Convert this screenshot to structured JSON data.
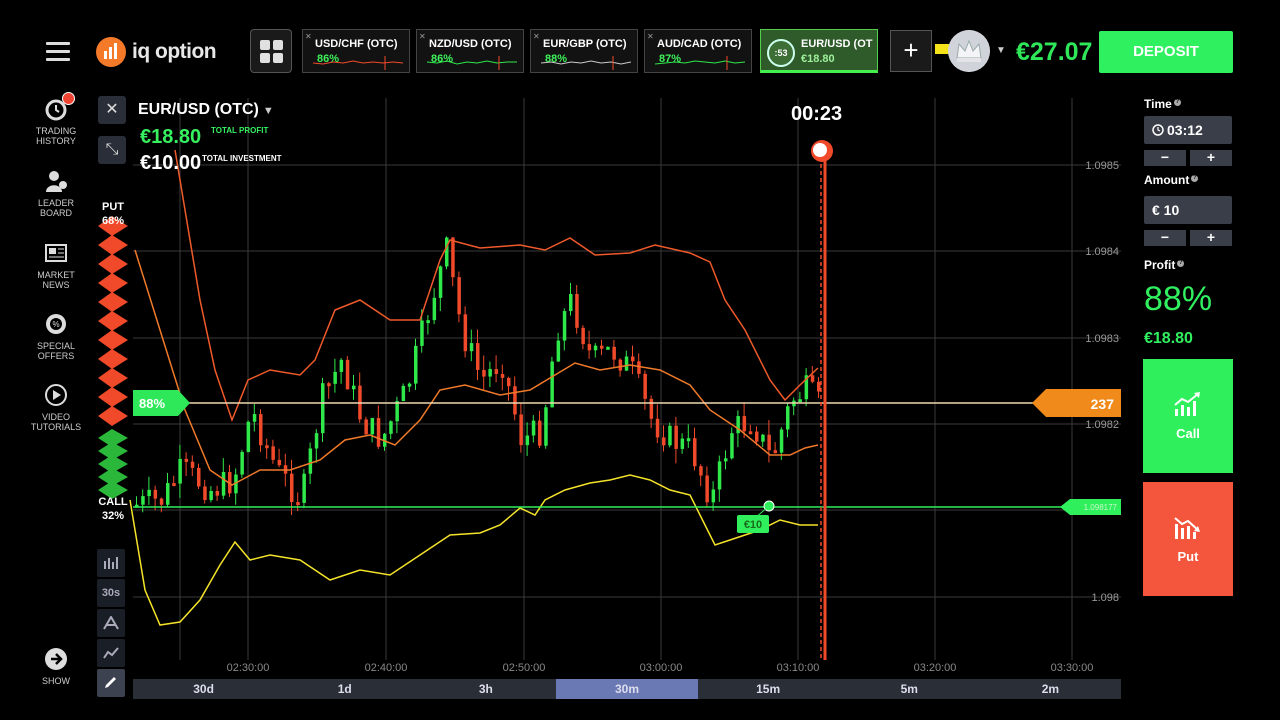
{
  "app": {
    "logo_text": "iq option",
    "balance": "€27.07",
    "deposit_label": "DEPOSIT"
  },
  "asset_tabs": [
    {
      "name": "USD/CHF (OTC)",
      "pct": "86%"
    },
    {
      "name": "NZD/USD (OTC)",
      "pct": "86%"
    },
    {
      "name": "EUR/GBP (OTC)",
      "pct": "88%"
    },
    {
      "name": "AUD/CAD (OTC)",
      "pct": "87%"
    },
    {
      "name": "EUR/USD (OT",
      "pct": "€18.80",
      "timer": ":53",
      "active": true
    }
  ],
  "sidebar": {
    "items": [
      {
        "label_1": "TRADING",
        "label_2": "HISTORY",
        "icon": "history-icon"
      },
      {
        "label_1": "LEADER",
        "label_2": "BOARD",
        "icon": "leaderboard-icon"
      },
      {
        "label_1": "MARKET",
        "label_2": "NEWS",
        "icon": "news-icon"
      },
      {
        "label_1": "SPECIAL",
        "label_2": "OFFERS",
        "icon": "offers-icon"
      },
      {
        "label_1": "VIDEO",
        "label_2": "TUTORIALS",
        "icon": "play-icon"
      },
      {
        "label_1": "SHOW",
        "label_2": "",
        "icon": "arrow-right-icon"
      }
    ]
  },
  "chart_header": {
    "asset": "EUR/USD (OTC)",
    "total_profit": "€18.80",
    "total_profit_label": "TOTAL PROFIT",
    "total_investment": "€10.00",
    "total_investment_label": "TOTAL INVESTMENT",
    "countdown": "00:23"
  },
  "sentiment": {
    "put_label": "PUT",
    "put_pct": "68%",
    "call_label": "CALL",
    "call_pct": "32%"
  },
  "markers": {
    "payout_tag": "88%",
    "right_tag": "237",
    "deal_tag": "€10",
    "strike_tag": "1.098177"
  },
  "tools": [
    "30s"
  ],
  "chart_data": {
    "type": "candlestick",
    "x_ticks": [
      "02:30:00",
      "02:40:00",
      "02:50:00",
      "03:00:00",
      "03:10:00",
      "03:20:00",
      "03:30:00"
    ],
    "y_ticks": [
      "1.0985",
      "1.0984",
      "1.0983",
      "1.0982",
      "1.098"
    ],
    "indicators": [
      "Bollinger upper",
      "Bollinger middle",
      "Bollinger lower"
    ],
    "colors": {
      "up": "#2fe84a",
      "down": "#f04a2a",
      "upper_band": "#f05a2a",
      "middle_band": "#f07a2a",
      "lower_band": "#f5e32a",
      "grid": "#3a3a3a"
    }
  },
  "timeframes": [
    "30d",
    "1d",
    "3h",
    "30m",
    "15m",
    "5m",
    "2m"
  ],
  "active_timeframe": "30m",
  "right_panel": {
    "time_label": "Time",
    "time_value": "03:12",
    "amount_label": "Amount",
    "amount_value": "€ 10",
    "minus": "−",
    "plus": "+",
    "profit_label": "Profit",
    "profit_pct": "88%",
    "profit_amount": "€18.80",
    "call_label": "Call",
    "put_label": "Put"
  }
}
